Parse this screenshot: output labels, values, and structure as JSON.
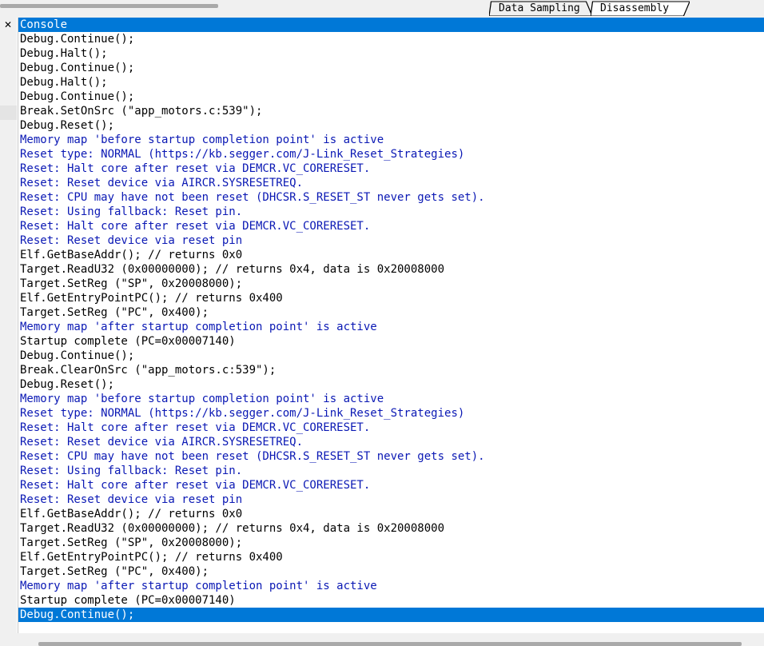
{
  "tabs": [
    {
      "label": "Data Sampling"
    },
    {
      "label": "Disassembly"
    }
  ],
  "console": {
    "close_glyph": "✕",
    "title": "Console",
    "lines": [
      {
        "text": "Debug.Continue();",
        "kind": "cmd"
      },
      {
        "text": "Debug.Halt();",
        "kind": "cmd"
      },
      {
        "text": "Debug.Continue();",
        "kind": "cmd"
      },
      {
        "text": "Debug.Halt();",
        "kind": "cmd"
      },
      {
        "text": "Debug.Continue();",
        "kind": "cmd"
      },
      {
        "text": "Break.SetOnSrc (\"app_motors.c:539\");",
        "kind": "cmd"
      },
      {
        "text": "Debug.Reset();",
        "kind": "cmd"
      },
      {
        "text": "Memory map 'before startup completion point' is active",
        "kind": "info"
      },
      {
        "text": "Reset type: NORMAL (https://kb.segger.com/J-Link_Reset_Strategies)",
        "kind": "info"
      },
      {
        "text": "Reset: Halt core after reset via DEMCR.VC_CORERESET.",
        "kind": "info"
      },
      {
        "text": "Reset: Reset device via AIRCR.SYSRESETREQ.",
        "kind": "info"
      },
      {
        "text": "Reset: CPU may have not been reset (DHCSR.S_RESET_ST never gets set).",
        "kind": "info"
      },
      {
        "text": "Reset: Using fallback: Reset pin.",
        "kind": "info"
      },
      {
        "text": "Reset: Halt core after reset via DEMCR.VC_CORERESET.",
        "kind": "info"
      },
      {
        "text": "Reset: Reset device via reset pin",
        "kind": "info"
      },
      {
        "text": "Elf.GetBaseAddr(); // returns 0x0",
        "kind": "cmd"
      },
      {
        "text": "Target.ReadU32 (0x00000000); // returns 0x4, data is 0x20008000",
        "kind": "cmd"
      },
      {
        "text": "Target.SetReg (\"SP\", 0x20008000);",
        "kind": "cmd"
      },
      {
        "text": "Elf.GetEntryPointPC(); // returns 0x400",
        "kind": "cmd"
      },
      {
        "text": "Target.SetReg (\"PC\", 0x400);",
        "kind": "cmd"
      },
      {
        "text": "Memory map 'after startup completion point' is active",
        "kind": "info"
      },
      {
        "text": "Startup complete (PC=0x00007140)",
        "kind": "cmd"
      },
      {
        "text": "Debug.Continue();",
        "kind": "cmd"
      },
      {
        "text": "Break.ClearOnSrc (\"app_motors.c:539\");",
        "kind": "cmd"
      },
      {
        "text": "Debug.Reset();",
        "kind": "cmd"
      },
      {
        "text": "Memory map 'before startup completion point' is active",
        "kind": "info"
      },
      {
        "text": "Reset type: NORMAL (https://kb.segger.com/J-Link_Reset_Strategies)",
        "kind": "info"
      },
      {
        "text": "Reset: Halt core after reset via DEMCR.VC_CORERESET.",
        "kind": "info"
      },
      {
        "text": "Reset: Reset device via AIRCR.SYSRESETREQ.",
        "kind": "info"
      },
      {
        "text": "Reset: CPU may have not been reset (DHCSR.S_RESET_ST never gets set).",
        "kind": "info"
      },
      {
        "text": "Reset: Using fallback: Reset pin.",
        "kind": "info"
      },
      {
        "text": "Reset: Halt core after reset via DEMCR.VC_CORERESET.",
        "kind": "info"
      },
      {
        "text": "Reset: Reset device via reset pin",
        "kind": "info"
      },
      {
        "text": "Elf.GetBaseAddr(); // returns 0x0",
        "kind": "cmd"
      },
      {
        "text": "Target.ReadU32 (0x00000000); // returns 0x4, data is 0x20008000",
        "kind": "cmd"
      },
      {
        "text": "Target.SetReg (\"SP\", 0x20008000);",
        "kind": "cmd"
      },
      {
        "text": "Elf.GetEntryPointPC(); // returns 0x400",
        "kind": "cmd"
      },
      {
        "text": "Target.SetReg (\"PC\", 0x400);",
        "kind": "cmd"
      },
      {
        "text": "Memory map 'after startup completion point' is active",
        "kind": "info"
      },
      {
        "text": "Startup complete (PC=0x00007140)",
        "kind": "cmd"
      },
      {
        "text": "Debug.Continue();",
        "kind": "selected"
      }
    ]
  },
  "colors": {
    "selection": "#0078d7",
    "info_text": "#0a18b4",
    "command_text": "#000000"
  }
}
